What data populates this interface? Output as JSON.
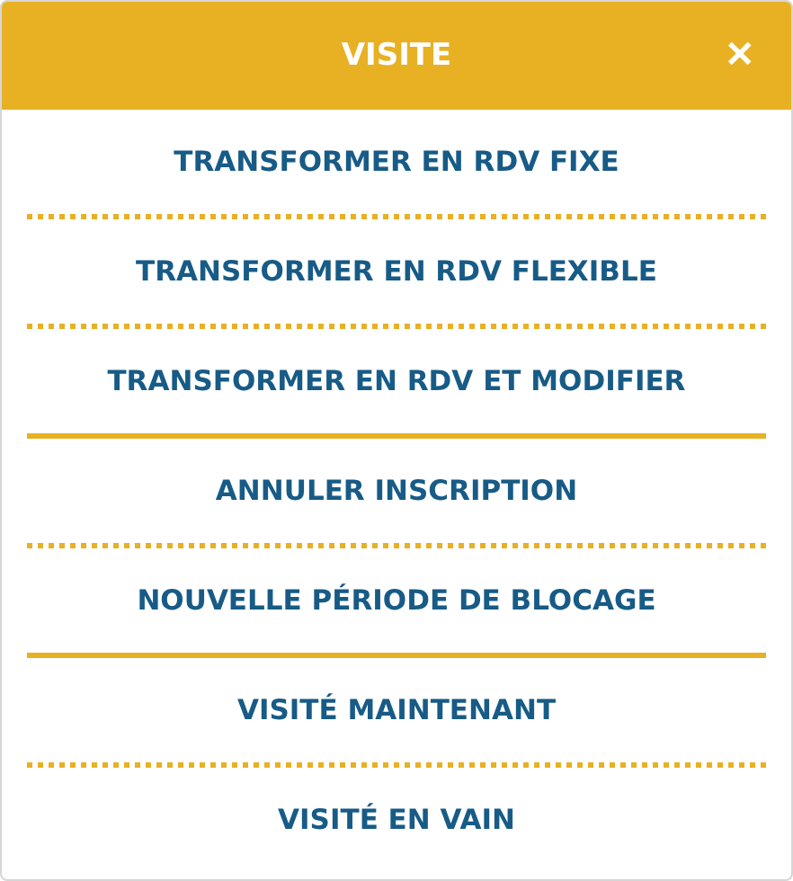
{
  "header": {
    "title": "VISITE",
    "close": "✕"
  },
  "groups": [
    {
      "items": [
        "TRANSFORMER EN RDV FIXE",
        "TRANSFORMER EN RDV FLEXIBLE",
        "TRANSFORMER EN RDV ET MODIFIER"
      ]
    },
    {
      "items": [
        "ANNULER INSCRIPTION",
        "NOUVELLE PÉRIODE DE BLOCAGE"
      ]
    },
    {
      "items": [
        "VISITÉ MAINTENANT",
        "VISITÉ EN VAIN"
      ]
    }
  ]
}
